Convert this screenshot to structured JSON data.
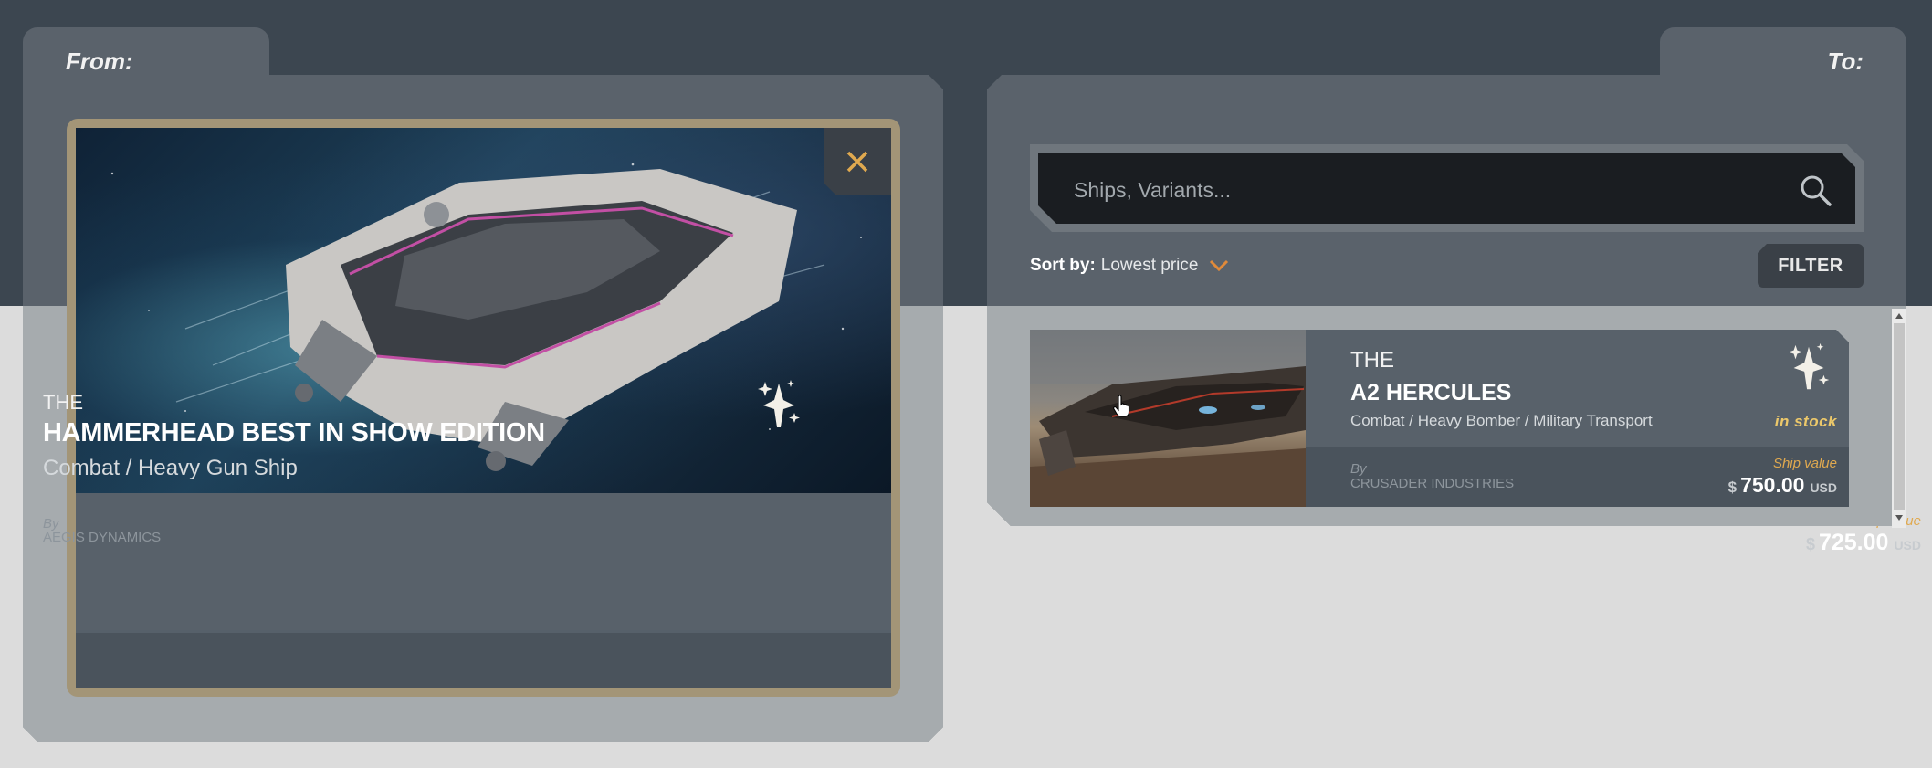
{
  "from": {
    "tab_label": "From:",
    "card": {
      "prefix": "THE",
      "name": "HAMMERHEAD BEST IN SHOW EDITION",
      "role": "Combat / Heavy Gun Ship",
      "by_label": "By",
      "manufacturer": "AEGIS DYNAMICS",
      "value_label": "Ship value",
      "currency_symbol": "$",
      "price": "725.00",
      "currency": "USD",
      "badge_icon": "ship-badge-icon",
      "close_icon": "close-icon"
    }
  },
  "to": {
    "tab_label": "To:",
    "search": {
      "placeholder": "Ships, Variants...",
      "value": "",
      "icon": "search-icon"
    },
    "sort": {
      "label": "Sort by:",
      "value": "Lowest price",
      "icon": "chevron-down-icon"
    },
    "filter_label": "FILTER",
    "results": [
      {
        "prefix": "THE",
        "name": "A2 HERCULES",
        "role": "Combat / Heavy Bomber / Military Transport",
        "stock": "in stock",
        "by_label": "By",
        "manufacturer": "CRUSADER INDUSTRIES",
        "value_label": "Ship value",
        "currency_symbol": "$",
        "price": "750.00",
        "currency": "USD"
      }
    ]
  },
  "colors": {
    "background_top": "#3c4650",
    "background_bottom": "#dcdcdc",
    "panel": "#5a626b",
    "panel_lower": "#a6abae",
    "card_frame": "#a39577",
    "accent_orange": "#e0a94f",
    "stock_yellow": "#ecc86a",
    "search_box": "#1a1d21"
  }
}
